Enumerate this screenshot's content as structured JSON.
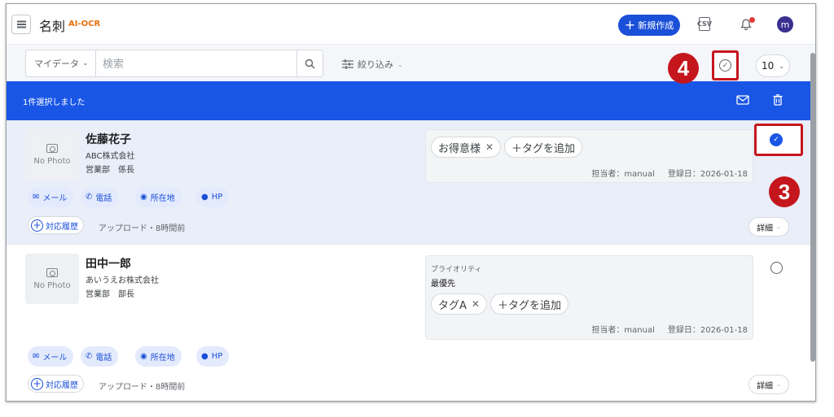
{
  "header": {
    "title": "名刺",
    "badge": "AI-OCR",
    "new_button": "新規作成",
    "csv_label": "CSV",
    "avatar_initial": "m",
    "accent_color": "#1a4fd8"
  },
  "toolbar": {
    "scope_label": "マイデータ",
    "search_placeholder": "検索",
    "filter_label": "絞り込み",
    "page_size": "10"
  },
  "selection_bar": {
    "text": "1件選択しました",
    "color": "#1a56e6"
  },
  "markers": {
    "m4": "4",
    "m3": "3"
  },
  "cards": [
    {
      "photo_label": "No Photo",
      "name": "佐藤花子",
      "company": "ABC株式会社",
      "dept": "営業部　係長",
      "selected": true,
      "tags": [
        "お得意様"
      ],
      "add_tag": "＋タグを追加",
      "owner": "担当者：manual",
      "registered": "登録日：2026-01-18",
      "actions": {
        "mail": "メール",
        "phone": "電話",
        "address": "所在地",
        "hp": "HP"
      },
      "history": "対応履歴",
      "upload": "アップロード・8時間前",
      "detail": "詳細"
    },
    {
      "photo_label": "No Photo",
      "name": "田中一郎",
      "company": "あいうえお株式会社",
      "dept": "営業部　部長",
      "selected": false,
      "priority_label": "プライオリティ",
      "priority_value": "最優先",
      "tags": [
        "タグA"
      ],
      "add_tag": "＋タグを追加",
      "owner": "担当者：manual",
      "registered": "登録日：2026-01-18",
      "actions": {
        "mail": "メール",
        "phone": "電話",
        "address": "所在地",
        "hp": "HP"
      },
      "history": "対応履歴",
      "upload": "アップロード・8時間前",
      "detail": "詳細"
    }
  ]
}
